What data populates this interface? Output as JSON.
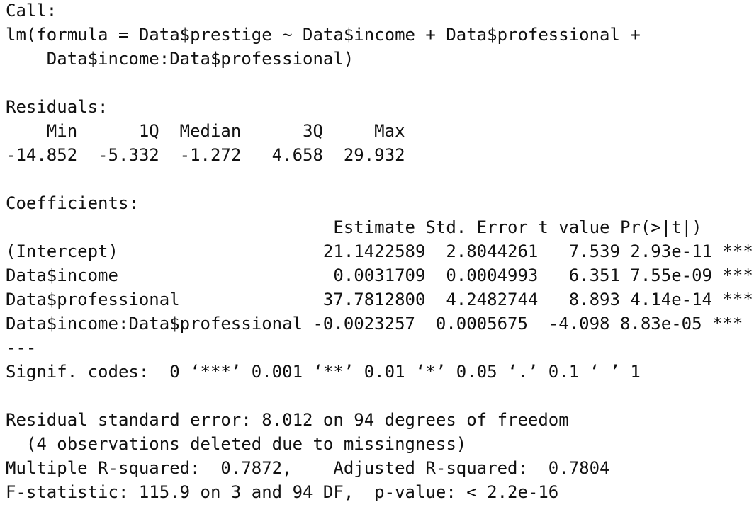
{
  "console": {
    "lines": [
      "Call:",
      "lm(formula = Data$prestige ~ Data$income + Data$professional +",
      "    Data$income:Data$professional)",
      "",
      "Residuals:",
      "    Min      1Q  Median      3Q     Max ",
      "-14.852  -5.332  -1.272   4.658  29.932 ",
      "",
      "Coefficients:",
      "                                Estimate Std. Error t value Pr(>|t|)    ",
      "(Intercept)                    21.1422589  2.8044261   7.539 2.93e-11 ***",
      "Data$income                     0.0031709  0.0004993   6.351 7.55e-09 ***",
      "Data$professional              37.7812800  4.2482744   8.893 4.14e-14 ***",
      "Data$income:Data$professional -0.0023257  0.0005675  -4.098 8.83e-05 ***",
      "---",
      "Signif. codes:  0 ‘***’ 0.001 ‘**’ 0.01 ‘*’ 0.05 ‘.’ 0.1 ‘ ’ 1",
      "",
      "Residual standard error: 8.012 on 94 degrees of freedom",
      "  (4 observations deleted due to missingness)",
      "Multiple R-squared:  0.7872,\tAdjusted R-squared:  0.7804 ",
      "F-statistic: 115.9 on 3 and 94 DF,  p-value: < 2.2e-16"
    ]
  }
}
